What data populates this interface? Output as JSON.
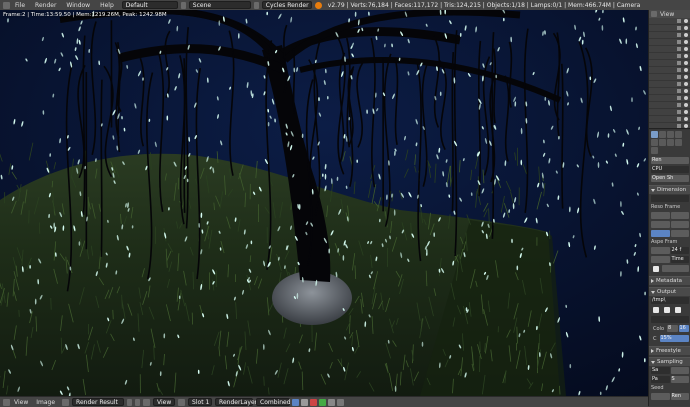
{
  "topbar": {
    "menus": [
      "File",
      "Render",
      "Window",
      "Help"
    ],
    "layout": "Default",
    "scene": "Scene",
    "engine": "Cycles Render",
    "stats": "v2.79 | Verts:76,184 | Faces:117,172 | Tris:124,215 | Objects:1/18 | Lamps:0/1 | Mem:466.74M | Camera"
  },
  "viewport": {
    "overlay": "Frame:2 | Time:13:59.50 | Mem:1219.26M, Peak: 1242.98M"
  },
  "outliner": {
    "header": "View",
    "row_count": 16
  },
  "properties": {
    "tab_count": 9,
    "render_label": "Ren",
    "device_label": "CPU",
    "open_sh_label": "Open Sh",
    "dimensions_title": "Dimension",
    "res_label": "Reso",
    "frame_label": "Frame",
    "aspect_label": "Aspe",
    "frame_rate_label": "Fram",
    "frame_rate_value": "24 f",
    "time_label": "Time",
    "metadata_title": "Metadata",
    "output_title": "Output",
    "output_path": "/tmp\\",
    "c_label": "C",
    "percent": "15%",
    "cold_label": "Colo",
    "bit_8": "8",
    "bit_16": "16",
    "freestyle_title": "Freestyle",
    "sampling_title": "Sampling",
    "samples_label": "Sa",
    "pa_label": "Pa",
    "s_label": "S",
    "seed_label": "Seed",
    "ren_label2": "Ren"
  },
  "bottombar": {
    "menus": [
      "View",
      "Image"
    ],
    "image_name": "Render Result",
    "view_label": "View",
    "slot": "Slot 1",
    "layer": "RenderLayer",
    "pass": "Combined"
  },
  "colors": {
    "sky": "#06122c",
    "grass": "#1c2e15",
    "fireflies": "#d8fff4",
    "accent": "#5b84c4"
  }
}
